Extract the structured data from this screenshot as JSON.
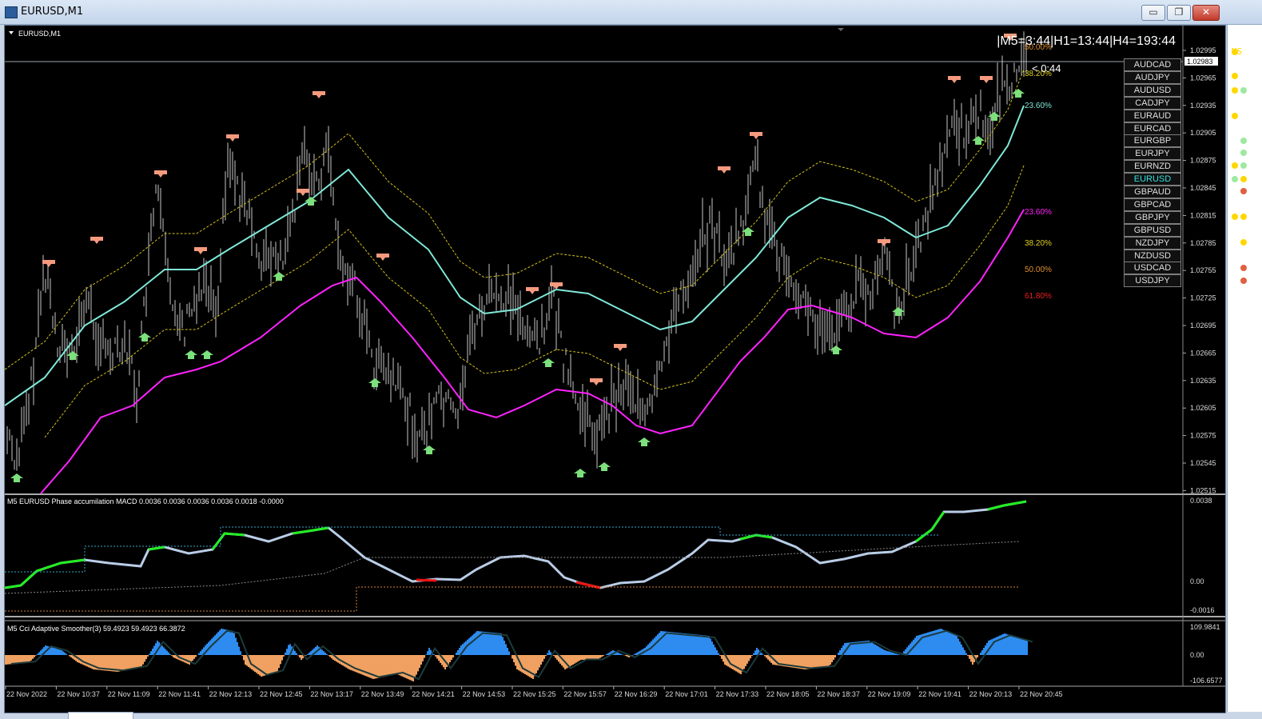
{
  "window": {
    "title": "EURUSD,M1"
  },
  "window_buttons": {
    "minimize": "▭",
    "restore": "❐",
    "close": "✕"
  },
  "chart": {
    "symbol_label": "EURUSD,M1",
    "timer_text": "|M5=3:44|H1=13:44|H4=193:44",
    "countdown": "< 0:44",
    "current_price": "1.02983",
    "price_ticks": [
      "1.02995",
      "1.02965",
      "1.02935",
      "1.02905",
      "1.02875",
      "1.02845",
      "1.02815",
      "1.02785",
      "1.02755",
      "1.02725",
      "1.02695",
      "1.02665",
      "1.02635",
      "1.02605",
      "1.02575",
      "1.02545",
      "1.02515"
    ],
    "fib_upper": [
      "50.00%",
      "38.20%",
      "23.60%"
    ],
    "fib_lower": [
      "23.60%",
      "38.20%",
      "50.00%",
      "61.80%"
    ],
    "colors": {
      "price": "#c8c8c8",
      "ma_aqua": "#7fe8d8",
      "ma_magenta": "#ff22ff",
      "band": "#d4c21a",
      "sell": "#f59a7e",
      "buy": "#7ce07c"
    }
  },
  "symbols": [
    "AUDCAD",
    "AUDJPY",
    "AUDUSD",
    "CADJPY",
    "EURAUD",
    "EURCAD",
    "EURGBP",
    "EURJPY",
    "EURNZD",
    "EURUSD",
    "GBPAUD",
    "GBPCAD",
    "GBPJPY",
    "GBPUSD",
    "NZDJPY",
    "NZDUSD",
    "USDCAD",
    "USDJPY"
  ],
  "active_symbol": "EURUSD",
  "macd": {
    "label": "M5 EURUSD Phase accumilation MACD 0.0036 0.0036 0.0036 0.0036 0.0018 -0.0000",
    "ticks": [
      "0.0038",
      "0.00",
      "-0.0016"
    ],
    "colors": {
      "line": "#b9cde6",
      "up": "#22ee22",
      "down": "#ee1111",
      "level_cyan": "#3aa7c8",
      "level_orange": "#d9853a"
    }
  },
  "cci": {
    "label": "M5 Cci Adaptive Smoother(3) 59.4923 59.4923 66.3872",
    "ticks": [
      "109.9841",
      "0.00",
      "-106.6577"
    ],
    "colors": {
      "pos": "#2e8cf0",
      "neg": "#f0a060",
      "line": "#1d3a3a"
    }
  },
  "time_axis": [
    "22 Nov 2022",
    "22 Nov 10:37",
    "22 Nov 11:09",
    "22 Nov 11:41",
    "22 Nov 12:13",
    "22 Nov 12:45",
    "22 Nov 13:17",
    "22 Nov 13:49",
    "22 Nov 14:21",
    "22 Nov 14:53",
    "22 Nov 15:25",
    "22 Nov 15:57",
    "22 Nov 16:29",
    "22 Nov 17:01",
    "22 Nov 17:33",
    "22 Nov 18:05",
    "22 Nov 18:37",
    "22 Nov 19:09",
    "22 Nov 19:41",
    "22 Nov 20:13",
    "22 Nov 20:45"
  ]
}
